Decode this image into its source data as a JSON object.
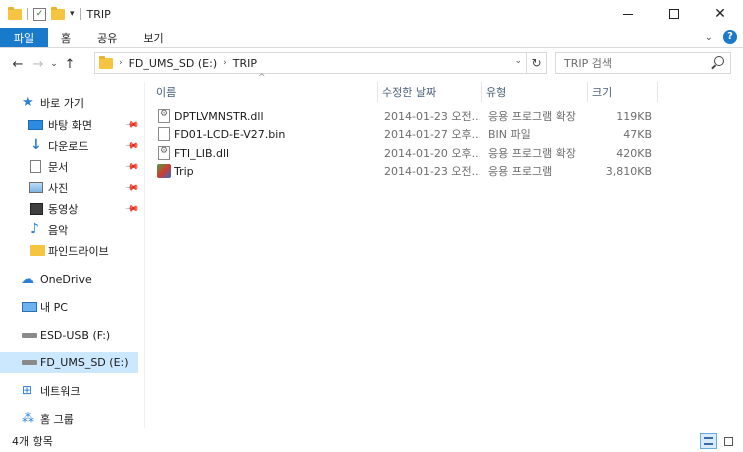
{
  "window": {
    "title": "TRIP"
  },
  "title_controls": {
    "minimize": "—",
    "maximize": "",
    "close": "✕"
  },
  "ribbon": {
    "tabs": [
      "파일",
      "홈",
      "공유",
      "보기"
    ]
  },
  "address": {
    "crumbs": [
      "FD_UMS_SD (E:)",
      "TRIP"
    ]
  },
  "search": {
    "placeholder": "TRIP 검색"
  },
  "sidebar": {
    "quick_access": "바로 가기",
    "items": [
      {
        "label": "바탕 화면",
        "icon": "desktop-icon",
        "pinned": true
      },
      {
        "label": "다운로드",
        "icon": "download-icon",
        "pinned": true
      },
      {
        "label": "문서",
        "icon": "document-icon",
        "pinned": true
      },
      {
        "label": "사진",
        "icon": "pictures-icon",
        "pinned": true
      },
      {
        "label": "동영상",
        "icon": "video-icon",
        "pinned": true
      },
      {
        "label": "음악",
        "icon": "music-icon",
        "pinned": false
      },
      {
        "label": "파인드라이브",
        "icon": "folder-icon",
        "pinned": false
      }
    ],
    "onedrive": "OneDrive",
    "this_pc": "내 PC",
    "drives": [
      {
        "label": "ESD-USB (F:)",
        "selected": false
      },
      {
        "label": "FD_UMS_SD (E:)",
        "selected": true
      }
    ],
    "network": "네트워크",
    "homegroup": "홈 그룹"
  },
  "columns": {
    "name": "이름",
    "date": "수정한 날짜",
    "type": "유형",
    "size": "크기"
  },
  "files": [
    {
      "name": "DPTLVMNSTR.dll",
      "date": "2014-01-23 오전...",
      "type": "응용 프로그램 확장",
      "size": "119KB",
      "icon": "dll-file-icon"
    },
    {
      "name": "FD01-LCD-E-V27.bin",
      "date": "2014-01-27 오후...",
      "type": "BIN 파일",
      "size": "47KB",
      "icon": "bin-file-icon"
    },
    {
      "name": "FTI_LIB.dll",
      "date": "2014-01-20 오후...",
      "type": "응용 프로그램 확장",
      "size": "420KB",
      "icon": "dll-file-icon"
    },
    {
      "name": "Trip",
      "date": "2014-01-23 오전...",
      "type": "응용 프로그램",
      "size": "3,810KB",
      "icon": "application-icon"
    }
  ],
  "status": {
    "item_count": "4개 항목"
  },
  "colors": {
    "accent": "#1979ca",
    "selection": "#cce8ff"
  }
}
